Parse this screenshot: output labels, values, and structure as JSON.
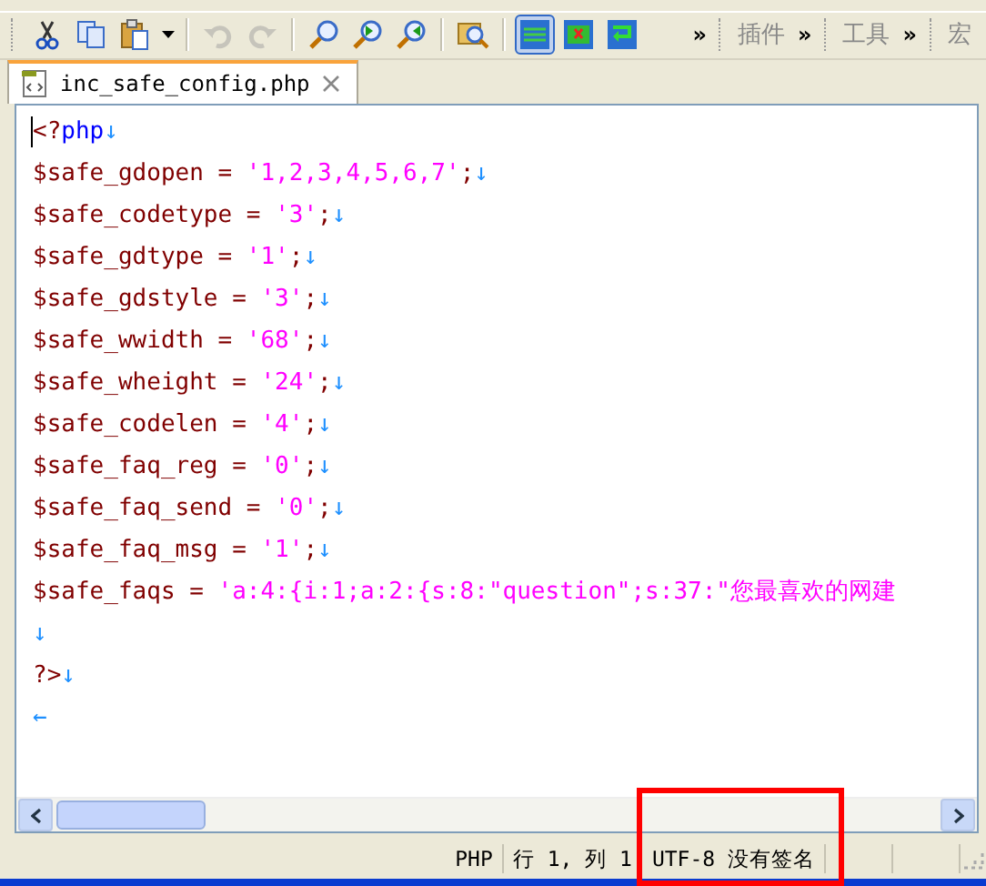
{
  "toolbar": {
    "groups": [
      {
        "buttons": [
          {
            "kind": "cut",
            "disabled": false,
            "pressed": false
          },
          {
            "kind": "copy",
            "disabled": false,
            "pressed": false
          },
          {
            "kind": "paste",
            "disabled": false,
            "pressed": false
          },
          {
            "kind": "dropdown",
            "disabled": false,
            "pressed": false
          }
        ]
      },
      {
        "buttons": [
          {
            "kind": "undo",
            "disabled": true,
            "pressed": false
          },
          {
            "kind": "redo",
            "disabled": true,
            "pressed": false
          }
        ]
      },
      {
        "buttons": [
          {
            "kind": "find",
            "disabled": false,
            "pressed": false
          },
          {
            "kind": "find-prev",
            "disabled": false,
            "pressed": false
          },
          {
            "kind": "find-next",
            "disabled": false,
            "pressed": false
          }
        ]
      },
      {
        "buttons": [
          {
            "kind": "find-files",
            "disabled": false,
            "pressed": false
          }
        ]
      },
      {
        "buttons": [
          {
            "kind": "toggle-lines",
            "disabled": false,
            "pressed": true
          },
          {
            "kind": "toggle-close",
            "disabled": false,
            "pressed": false
          },
          {
            "kind": "toggle-wrap",
            "disabled": false,
            "pressed": false
          }
        ]
      }
    ],
    "sections": [
      {
        "chevron": "»",
        "label": "插件"
      },
      {
        "chevron": "»",
        "label": "工具"
      },
      {
        "chevron": "»",
        "label": "宏"
      }
    ]
  },
  "tabs": [
    {
      "label": "inc_safe_config.php",
      "selected": true
    }
  ],
  "editor": {
    "lines": [
      {
        "cursor": true,
        "tokens": [
          {
            "kind": "punct",
            "text": "<?"
          },
          {
            "kind": "keyword",
            "text": "php"
          },
          {
            "kind": "eol",
            "text": "↓"
          }
        ]
      },
      {
        "cursor": false,
        "tokens": [
          {
            "kind": "var",
            "text": "$safe_gdopen = "
          },
          {
            "kind": "string",
            "text": "'1,2,3,4,5,6,7'"
          },
          {
            "kind": "punct",
            "text": ";"
          },
          {
            "kind": "eol",
            "text": "↓"
          }
        ]
      },
      {
        "cursor": false,
        "tokens": [
          {
            "kind": "var",
            "text": "$safe_codetype = "
          },
          {
            "kind": "string",
            "text": "'3'"
          },
          {
            "kind": "punct",
            "text": ";"
          },
          {
            "kind": "eol",
            "text": "↓"
          }
        ]
      },
      {
        "cursor": false,
        "tokens": [
          {
            "kind": "var",
            "text": "$safe_gdtype = "
          },
          {
            "kind": "string",
            "text": "'1'"
          },
          {
            "kind": "punct",
            "text": ";"
          },
          {
            "kind": "eol",
            "text": "↓"
          }
        ]
      },
      {
        "cursor": false,
        "tokens": [
          {
            "kind": "var",
            "text": "$safe_gdstyle = "
          },
          {
            "kind": "string",
            "text": "'3'"
          },
          {
            "kind": "punct",
            "text": ";"
          },
          {
            "kind": "eol",
            "text": "↓"
          }
        ]
      },
      {
        "cursor": false,
        "tokens": [
          {
            "kind": "var",
            "text": "$safe_wwidth = "
          },
          {
            "kind": "string",
            "text": "'68'"
          },
          {
            "kind": "punct",
            "text": ";"
          },
          {
            "kind": "eol",
            "text": "↓"
          }
        ]
      },
      {
        "cursor": false,
        "tokens": [
          {
            "kind": "var",
            "text": "$safe_wheight = "
          },
          {
            "kind": "string",
            "text": "'24'"
          },
          {
            "kind": "punct",
            "text": ";"
          },
          {
            "kind": "eol",
            "text": "↓"
          }
        ]
      },
      {
        "cursor": false,
        "tokens": [
          {
            "kind": "var",
            "text": "$safe_codelen = "
          },
          {
            "kind": "string",
            "text": "'4'"
          },
          {
            "kind": "punct",
            "text": ";"
          },
          {
            "kind": "eol",
            "text": "↓"
          }
        ]
      },
      {
        "cursor": false,
        "tokens": [
          {
            "kind": "var",
            "text": "$safe_faq_reg = "
          },
          {
            "kind": "string",
            "text": "'0'"
          },
          {
            "kind": "punct",
            "text": ";"
          },
          {
            "kind": "eol",
            "text": "↓"
          }
        ]
      },
      {
        "cursor": false,
        "tokens": [
          {
            "kind": "var",
            "text": "$safe_faq_send = "
          },
          {
            "kind": "string",
            "text": "'0'"
          },
          {
            "kind": "punct",
            "text": ";"
          },
          {
            "kind": "eol",
            "text": "↓"
          }
        ]
      },
      {
        "cursor": false,
        "tokens": [
          {
            "kind": "var",
            "text": "$safe_faq_msg = "
          },
          {
            "kind": "string",
            "text": "'1'"
          },
          {
            "kind": "punct",
            "text": ";"
          },
          {
            "kind": "eol",
            "text": "↓"
          }
        ]
      },
      {
        "cursor": false,
        "tokens": [
          {
            "kind": "var",
            "text": "$safe_faqs = "
          },
          {
            "kind": "string",
            "text": "'a:4:{i:1;a:2:{s:8:\"question\";s:37:\"您最喜欢的网建"
          }
        ]
      },
      {
        "cursor": false,
        "tokens": [
          {
            "kind": "eol",
            "text": "↓"
          }
        ]
      },
      {
        "cursor": false,
        "tokens": [
          {
            "kind": "punct",
            "text": "?>"
          },
          {
            "kind": "eol",
            "text": "↓"
          }
        ]
      },
      {
        "cursor": false,
        "tokens": [
          {
            "kind": "eol",
            "text": "←"
          }
        ]
      }
    ]
  },
  "status_bar": {
    "fields": [
      "PHP",
      "行 1, 列 1",
      "UTF-8 没有签名"
    ]
  }
}
